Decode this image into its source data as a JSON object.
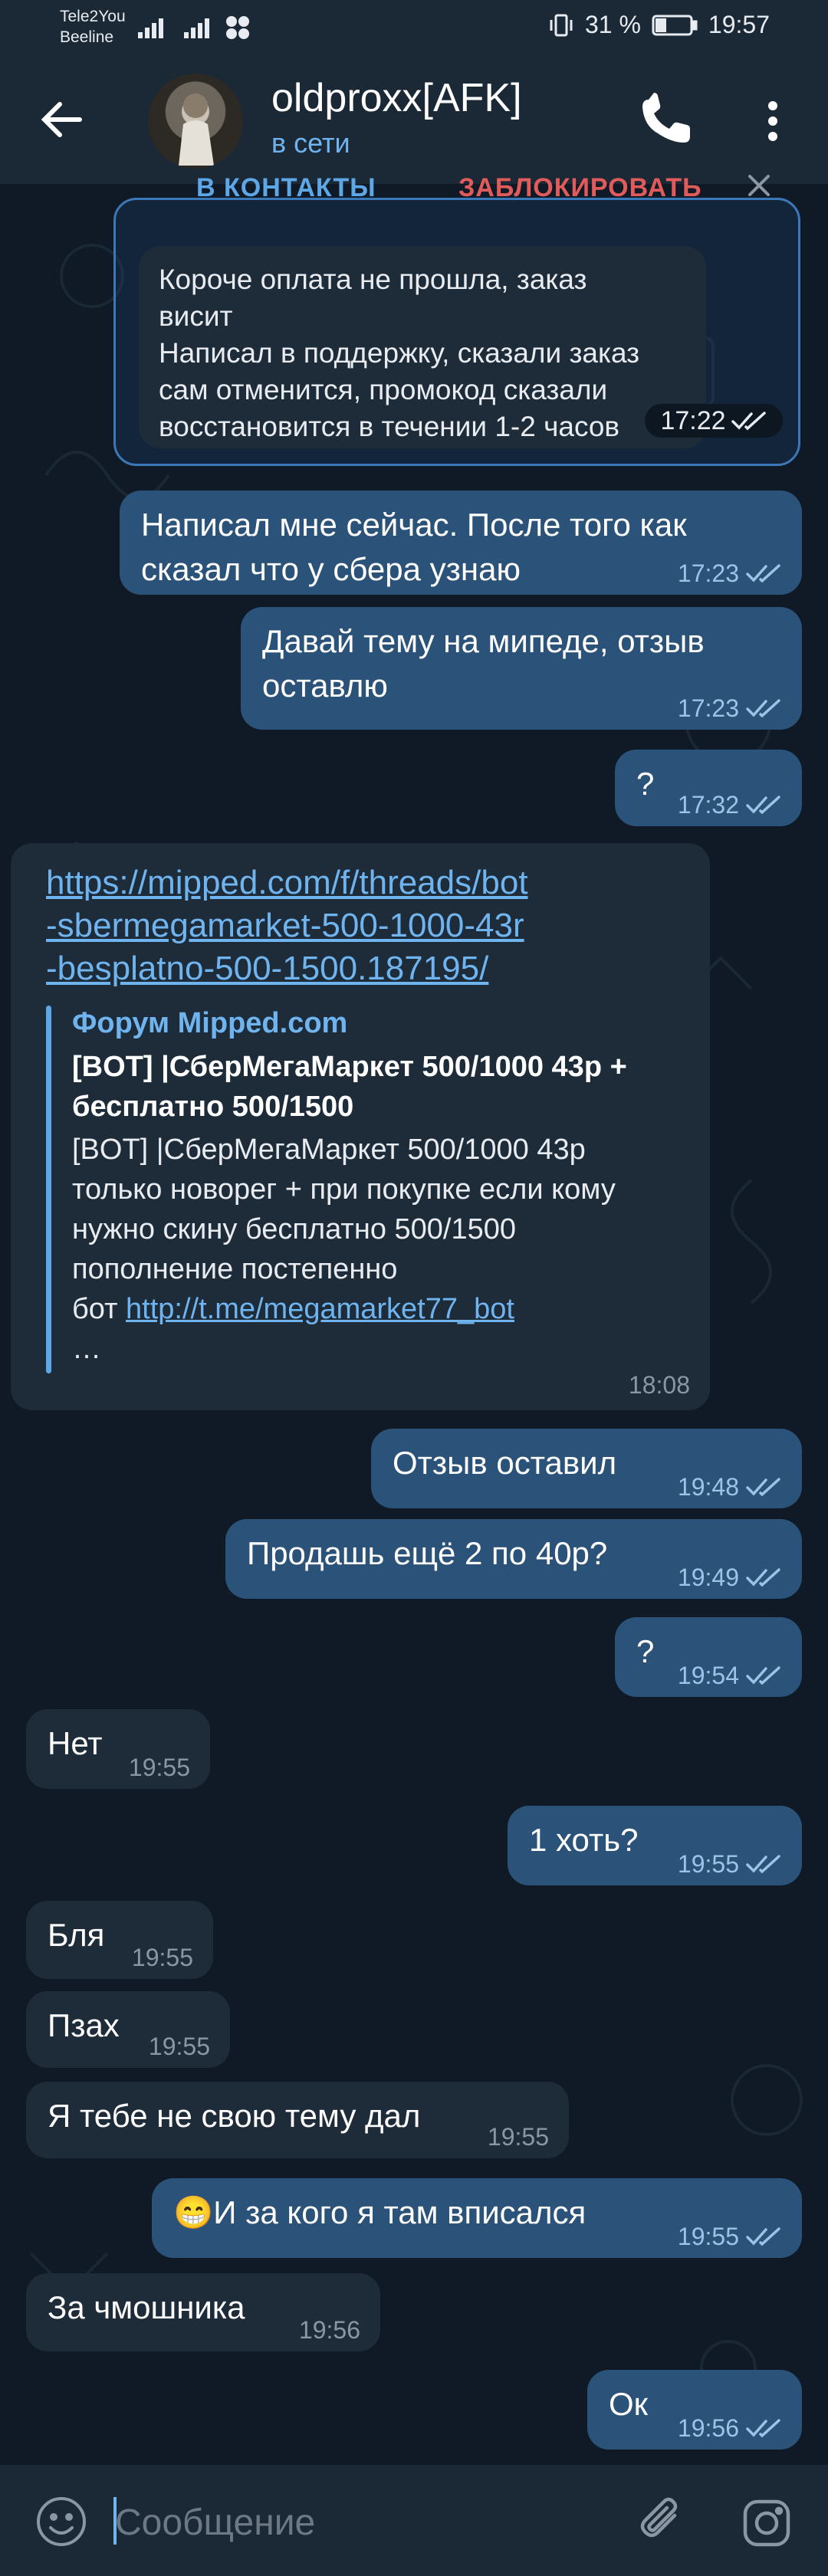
{
  "status_bar": {
    "carrier_1": "Tele2You",
    "carrier_2": "Beeline",
    "battery": "31 %",
    "time": "19:57"
  },
  "header": {
    "name": "oldproxx[AFK]",
    "status": "в сети"
  },
  "action_bar": {
    "add_contact": "В КОНТАКТЫ",
    "block": "ЗАБЛОКИРОВАТЬ"
  },
  "quoted_message": {
    "text": "Короче оплата не прошла, заказ\nвисит\nНаписал в поддержку, сказали заказ\nсам отменится, промокод сказали\nвосстановится в течении 1-2 часов",
    "time": "17:22"
  },
  "messages": [
    {
      "text": "Написал мне сейчас. После того как\nсказал что у сбера узнаю",
      "time": "17:23"
    },
    {
      "text": "Давай тему на мипеде, отзыв\nоставлю",
      "time": "17:23"
    },
    {
      "text": "?",
      "time": "17:32"
    },
    {
      "text": "Отзыв оставил",
      "time": "19:48"
    },
    {
      "text": "Продашь ещё 2 по 40р?",
      "time": "19:49"
    },
    {
      "text": "?",
      "time": "19:54"
    },
    {
      "text": "Нет",
      "time": "19:55"
    },
    {
      "text": "1 хоть?",
      "time": "19:55"
    },
    {
      "text": "Бля",
      "time": "19:55"
    },
    {
      "text": "Пзах",
      "time": "19:55"
    },
    {
      "text": "Я тебе не свою тему дал",
      "time": "19:55"
    },
    {
      "text": "😁И за кого я там вписался",
      "time": "19:55"
    },
    {
      "text": "За чмошника",
      "time": "19:56"
    },
    {
      "text": "Ок",
      "time": "19:56"
    }
  ],
  "link_message": {
    "url": "https://mipped.com/f/threads/bot\n-sbermegamarket-500-1000-43r\n-besplatno-500-1500.187195/",
    "site": "Форум Mipped.com",
    "title": "[BOT] |СберМегаМаркет 500/1000 43р +\nбесплатно 500/1500",
    "description": "[BOT] |СберМегаМаркет 500/1000 43р\nтолько новорег + при покупке если кому\nнужно скину бесплатно 500/1500\nпополнение постепенно\nбот ",
    "bot_link": "http://t.me/megamarket77_bot",
    "ellipsis": "…",
    "time": "18:08"
  },
  "input": {
    "placeholder": "Сообщение"
  },
  "colors": {
    "outgoing_bubble": "#2b5278",
    "incoming_bubble": "#1e2c3a",
    "accent": "#6fb4ee",
    "background": "#0e1621"
  }
}
